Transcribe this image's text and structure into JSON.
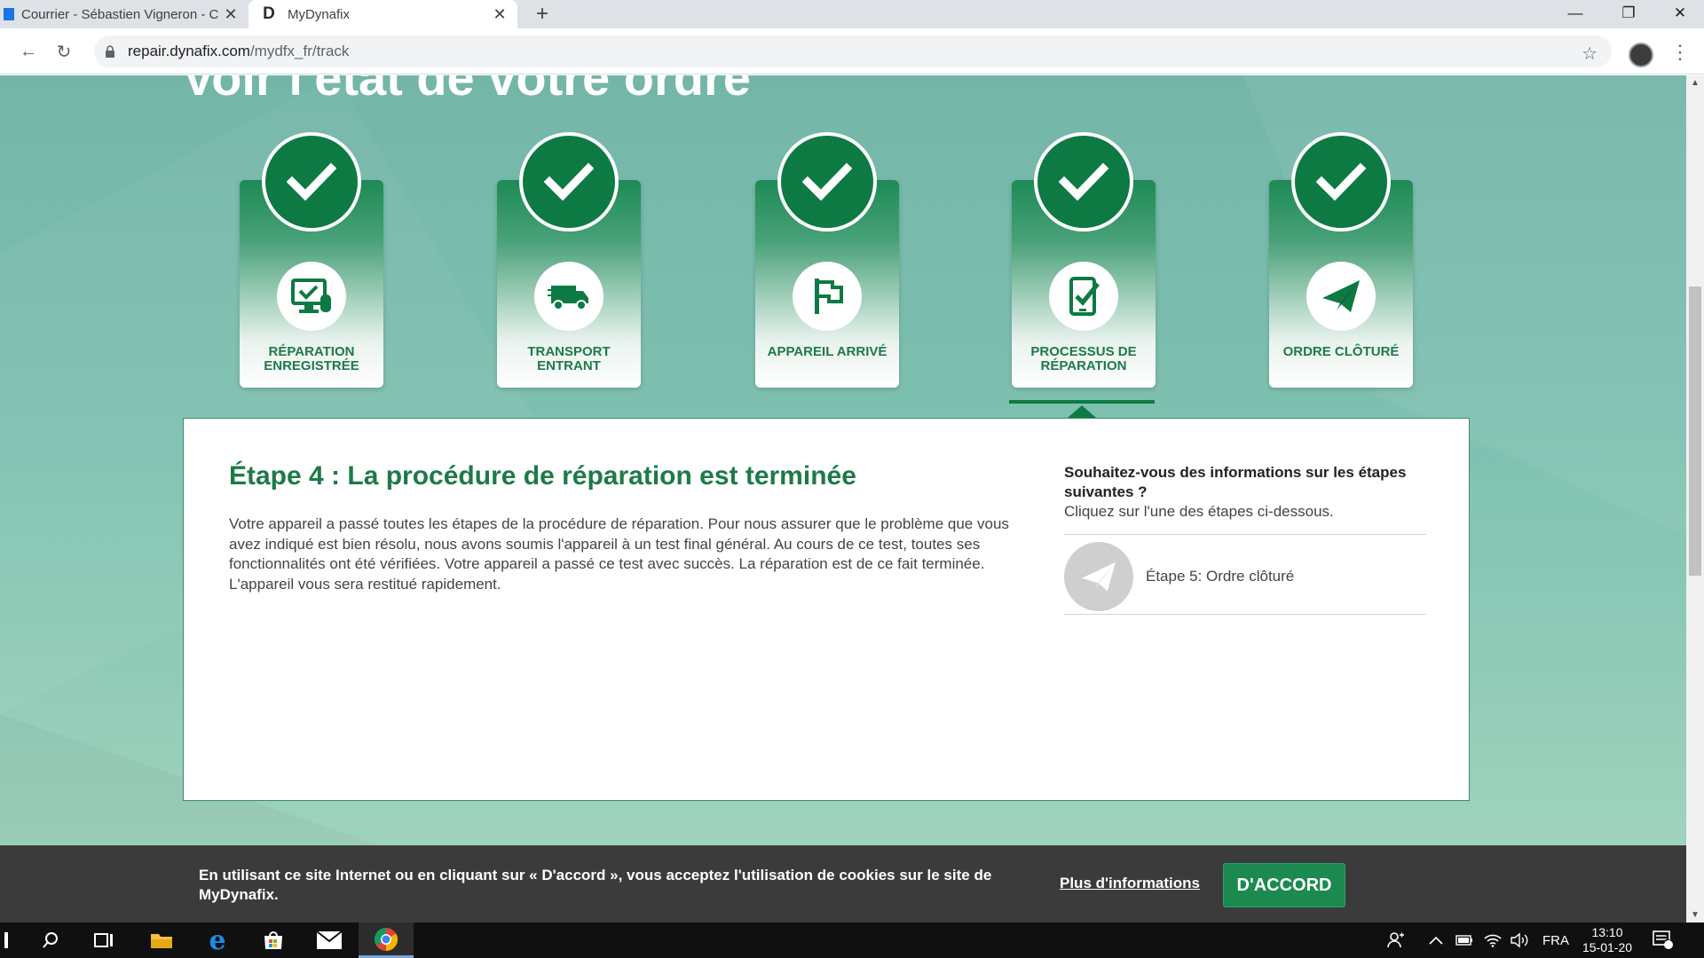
{
  "browser": {
    "tabs": [
      {
        "title": "Courrier - Sébastien Vigneron - C",
        "favicon": "mail-icon"
      },
      {
        "title": "MyDynafix",
        "favicon": "D",
        "active": true
      }
    ],
    "url_host": "repair.dynafix.com",
    "url_path": "/mydfx_fr/track"
  },
  "page": {
    "title": "Voir l'état de votre ordre",
    "steps": [
      {
        "label": "RÉPARATION ENREGISTRÉE",
        "icon": "computer-repair-icon",
        "status": "done"
      },
      {
        "label": "TRANSPORT ENTRANT",
        "icon": "truck-icon",
        "status": "done"
      },
      {
        "label": "APPAREIL ARRIVÉ",
        "icon": "flag-icon",
        "status": "done"
      },
      {
        "label": "PROCESSUS DE RÉPARATION",
        "icon": "phone-check-icon",
        "status": "done"
      },
      {
        "label": "ORDRE CLÔTURÉ",
        "icon": "paper-plane-icon",
        "status": "done"
      }
    ],
    "active_step_index": 4,
    "detail": {
      "title": "Étape 4 : La procédure de réparation est terminée",
      "text": "Votre appareil a passé toutes les étapes de la procédure de réparation. Pour nous assurer que le problème que vous avez indiqué est bien résolu, nous avons soumis l'appareil à un test final général. Au cours de ce test, toutes ses fonctionnalités ont été vérifiées. Votre appareil a passé ce test avec succès. La réparation est de ce fait terminée. L'appareil vous sera restitué rapidement.",
      "next_question": "Souhaitez-vous des informations sur les étapes suivantes ?",
      "next_hint": "Cliquez sur l'une des étapes ci-dessous.",
      "next_step_label": "Étape 5: Ordre clôturé"
    }
  },
  "cookie": {
    "text": "En utilisant ce site Internet ou en cliquant sur « D'accord », vous acceptez l'utilisation de cookies sur le site de MyDynafix.",
    "more_label": "Plus d'informations",
    "ok_label": "D'ACCORD"
  },
  "taskbar": {
    "language": "FRA",
    "time": "13:10",
    "date": "15-01-20",
    "notification_count": "1"
  },
  "colors": {
    "brand_green": "#0d7a43",
    "label_green": "#1d7a48",
    "teal_bg": "#7dbdad"
  }
}
